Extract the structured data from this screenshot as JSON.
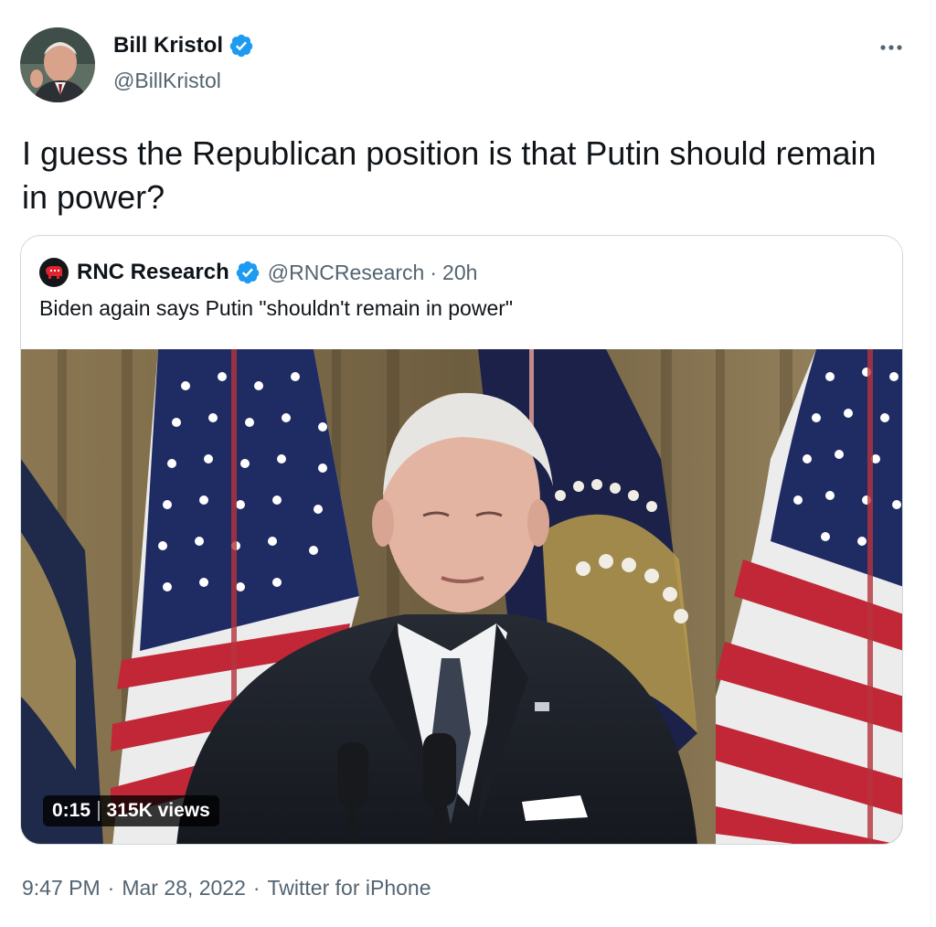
{
  "author": {
    "name": "Bill Kristol",
    "handle": "@BillKristol",
    "verified_color": "#1d9bf0"
  },
  "tweet": {
    "text": "I guess the Republican position is that Putin should remain in power?"
  },
  "quoted": {
    "name": "RNC Research",
    "handle": "@RNCResearch",
    "separator": "·",
    "time": "20h",
    "text": "Biden again says Putin \"shouldn't remain in power\"",
    "video": {
      "duration": "0:15",
      "views": "315K views"
    }
  },
  "footer": {
    "time": "9:47 PM",
    "date": "Mar 28, 2022",
    "source": "Twitter for iPhone",
    "separator": "·"
  },
  "icons": {
    "verified": "verified-badge-icon",
    "more": "more-options-icon"
  }
}
